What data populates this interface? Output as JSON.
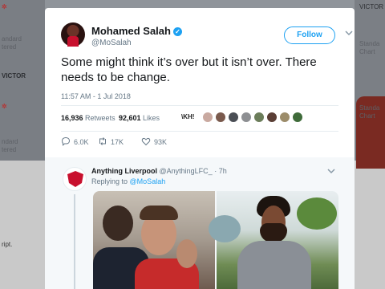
{
  "background": {
    "fragments": [
      {
        "text": "Standard",
        "x": 0,
        "y": 0
      },
      {
        "text": "BETVICTOR",
        "x": 0,
        "y": 0
      }
    ]
  },
  "tweet": {
    "author": {
      "name": "Mohamed Salah",
      "handle": "@MoSalah",
      "verified": true
    },
    "follow_label": "Follow",
    "text": "Some might think it’s over but it isn’t over. There needs to be change.",
    "timestamp": "11:57 AM - 1 Jul 2018",
    "stats": {
      "retweets_count": "16,936",
      "retweets_label": "Retweets",
      "likes_count": "92,601",
      "likes_label": "Likes"
    },
    "liker_text": "\\KH!",
    "actions": {
      "replies": "6.0K",
      "retweets": "17K",
      "likes": "93K"
    }
  },
  "reply": {
    "name": "Anything Liverpool",
    "handle": "@AnythingLFC_",
    "time": "7h",
    "replying_prefix": "Replying to",
    "replying_to": "@MoSalah"
  },
  "colors": {
    "accent": "#1da1f2",
    "muted": "#657786",
    "text": "#14171a",
    "liverpool_red": "#c8102e"
  },
  "icons": {
    "reply": "reply-icon",
    "retweet": "retweet-icon",
    "like": "heart-icon",
    "verified": "verified-badge-icon",
    "more": "chevron-down-icon"
  }
}
